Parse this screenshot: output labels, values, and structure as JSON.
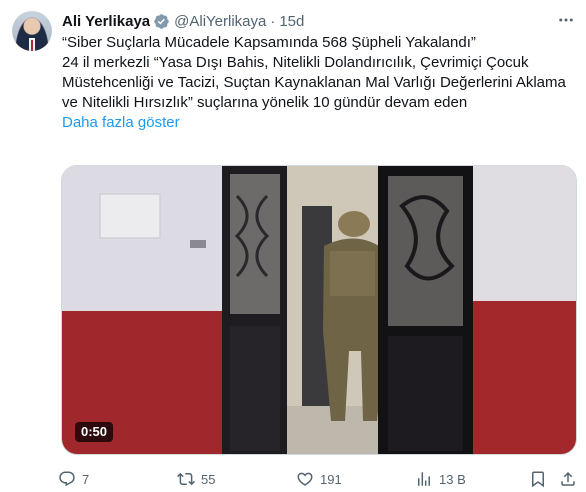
{
  "author": {
    "name": "Ali Yerlikaya",
    "handle": "@AliYerlikaya",
    "separator": "·",
    "time": "15d"
  },
  "tweet": {
    "lines": [
      "“Siber Suçlarla Mücadele Kapsamında 568 Şüpheli Yakalandı”",
      "24 il merkezli “Yasa Dışı Bahis, Nitelikli Dolandırıcılık, Çevrimiçi Çocuk",
      "Müstehcenliği ve Tacizi, Suçtan Kaynaklanan Mal Varlığı Değerlerini Aklama",
      "ve Nitelikli Hırsızlık” suçlarına yönelik 10 gündür devam eden"
    ],
    "show_more": "Daha fazla göster"
  },
  "media": {
    "duration": "0:50"
  },
  "actions": {
    "replies": "7",
    "retweets": "55",
    "likes": "191",
    "views": "13 B"
  },
  "colors": {
    "accent": "#1d9bf0",
    "verified": "#829aab",
    "muted": "#536471"
  }
}
